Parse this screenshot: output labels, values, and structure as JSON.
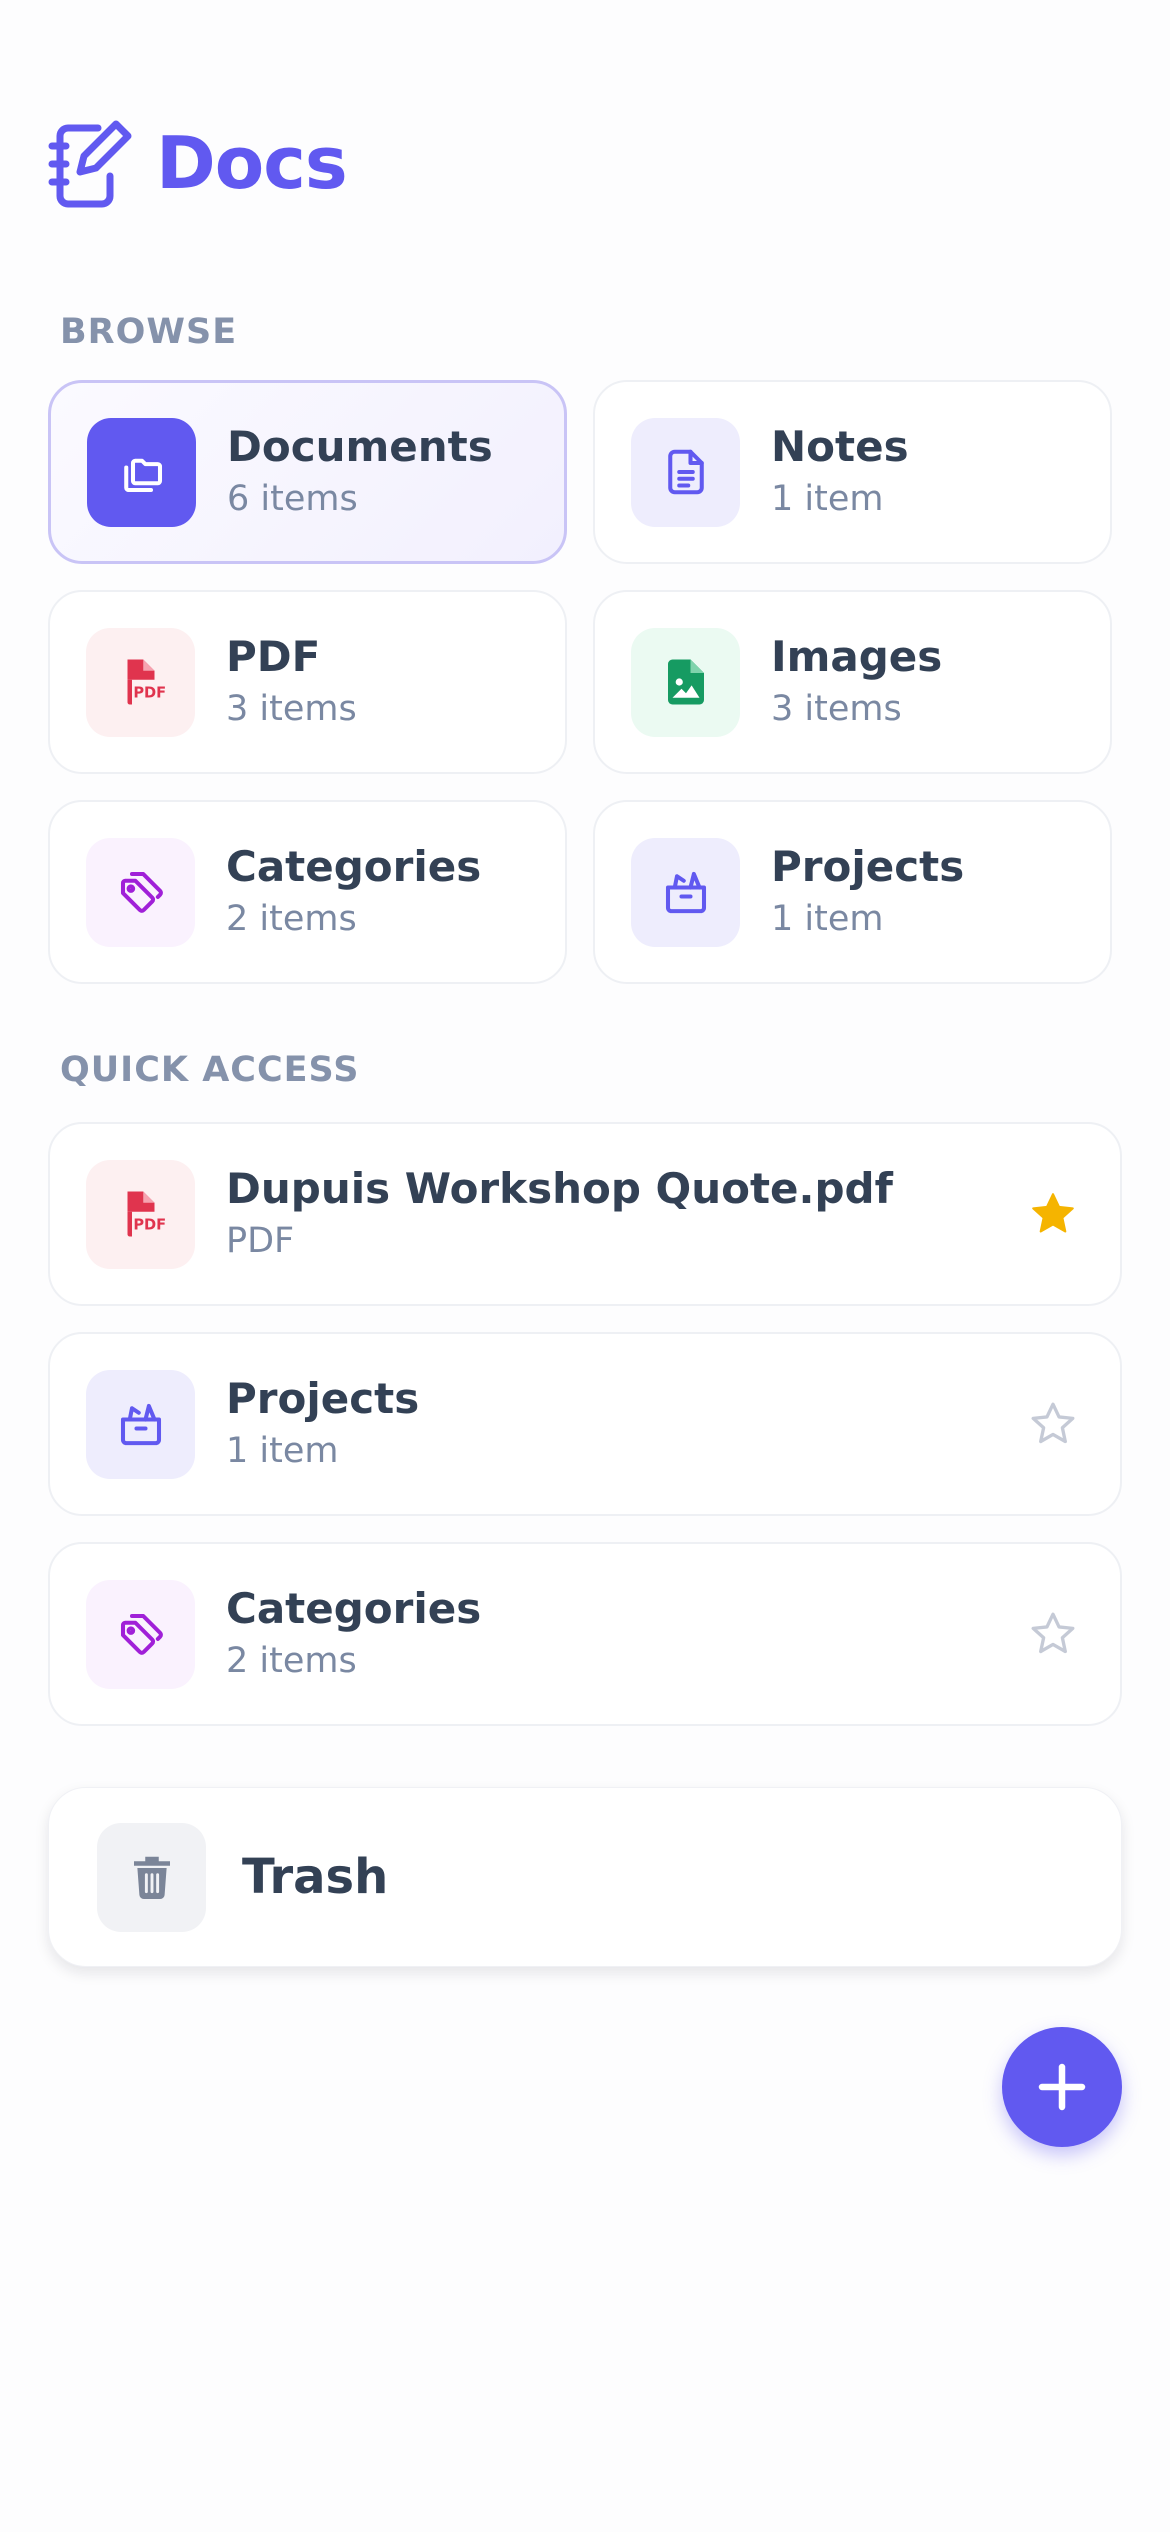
{
  "app": {
    "title": "Docs",
    "icon": "notebook-pen-icon"
  },
  "browse": {
    "label": "BROWSE",
    "items": [
      {
        "name": "Documents",
        "count": "6 items",
        "icon": "folders-icon",
        "selected": true
      },
      {
        "name": "Notes",
        "count": "1 item",
        "icon": "note-file-icon"
      },
      {
        "name": "PDF",
        "count": "3 items",
        "icon": "pdf-file-icon"
      },
      {
        "name": "Images",
        "count": "3 items",
        "icon": "image-file-icon"
      },
      {
        "name": "Categories",
        "count": "2 items",
        "icon": "tags-icon"
      },
      {
        "name": "Projects",
        "count": "1 item",
        "icon": "project-box-icon"
      }
    ]
  },
  "quick_access": {
    "label": "QUICK ACCESS",
    "items": [
      {
        "name": "Dupuis Workshop Quote.pdf",
        "sub": "PDF",
        "icon": "pdf-file-icon",
        "starred": true
      },
      {
        "name": "Projects",
        "sub": "1 item",
        "icon": "project-box-icon",
        "starred": false
      },
      {
        "name": "Categories",
        "sub": "2 items",
        "icon": "tags-icon",
        "starred": false
      }
    ]
  },
  "trash": {
    "label": "Trash",
    "icon": "trash-icon"
  },
  "fab": {
    "icon": "plus-icon"
  },
  "colors": {
    "accent": "#6159f0",
    "pdf": "#e0344e",
    "images": "#169b62",
    "categories": "#a020d8",
    "star_active": "#f5b400",
    "star_inactive": "#c5cad6"
  }
}
